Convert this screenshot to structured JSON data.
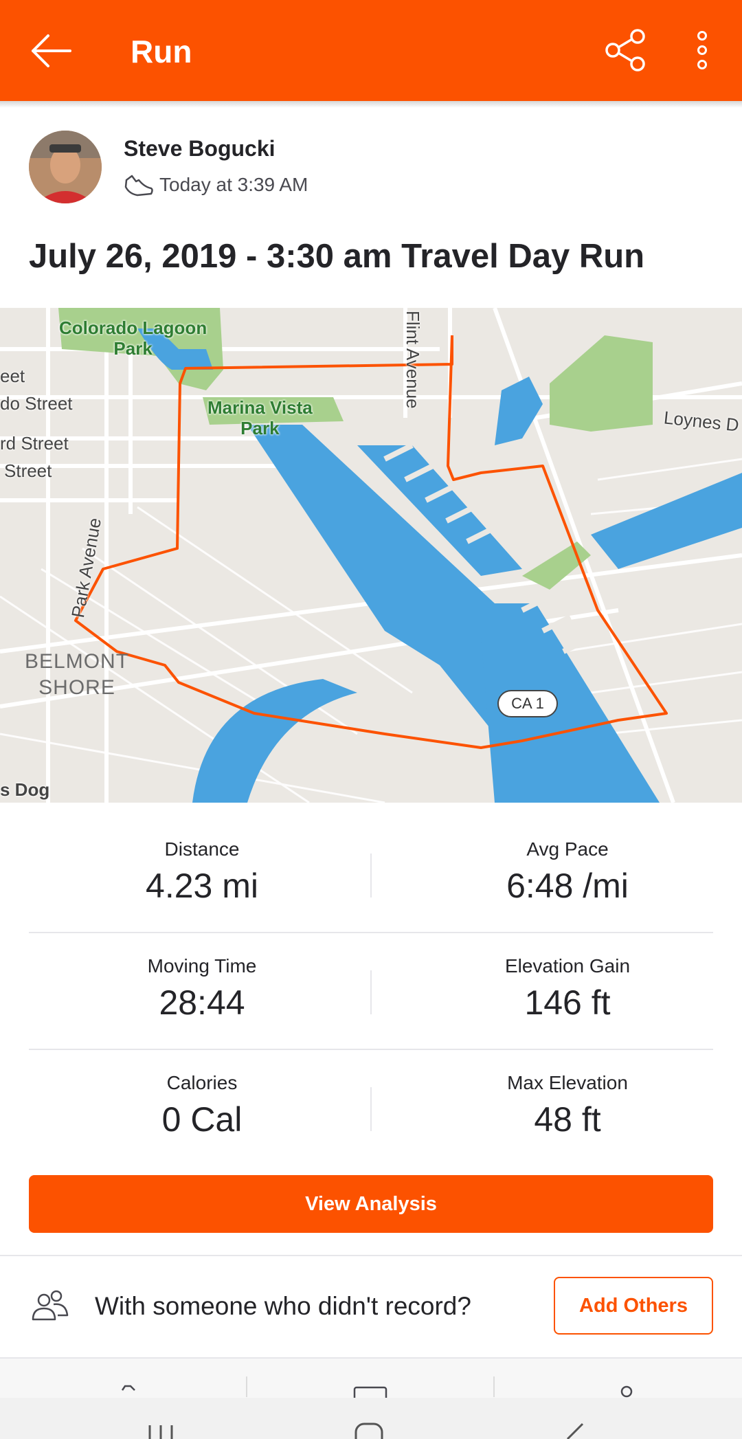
{
  "appbar": {
    "title": "Run",
    "background": "#fc5200",
    "icons": [
      "back-arrow-icon",
      "share-icon",
      "more-vert-icon"
    ]
  },
  "athlete": {
    "name": "Steve Bogucki",
    "timestamp": "Today at 3:39 AM",
    "activity_icon": "running-shoe-icon"
  },
  "activity": {
    "title": "July 26, 2019 - 3:30 am Travel Day Run"
  },
  "map": {
    "labels": {
      "colorado_lagoon_1": "Colorado Lagoon",
      "colorado_lagoon_2": "Park",
      "marina_vista_1": "Marina Vista",
      "marina_vista_2": "Park",
      "flint_avenue": "Flint Avenue",
      "ca1": "CA 1",
      "loynes": "Loynes D",
      "eet": "eet",
      "do_street": "do Street",
      "rd_street": "rd Street",
      "street": "Street",
      "park_avenue": "Park Avenue",
      "belmont": "BELMONT",
      "shore": "SHORE",
      "s_dog": "s Dog"
    },
    "route_color": "#fc5200",
    "water_color": "#4aa3df",
    "park_color": "#a8d08d"
  },
  "stats": [
    {
      "label": "Distance",
      "value": "4.23 mi"
    },
    {
      "label": "Avg Pace",
      "value": "6:48 /mi"
    },
    {
      "label": "Moving Time",
      "value": "28:44"
    },
    {
      "label": "Elevation Gain",
      "value": "146 ft"
    },
    {
      "label": "Calories",
      "value": "0 Cal"
    },
    {
      "label": "Max Elevation",
      "value": "48 ft"
    }
  ],
  "actions": {
    "view_analysis": "View Analysis",
    "with_someone": "With someone who didn't record?",
    "add_others": "Add Others"
  },
  "accent": "#fc5200"
}
